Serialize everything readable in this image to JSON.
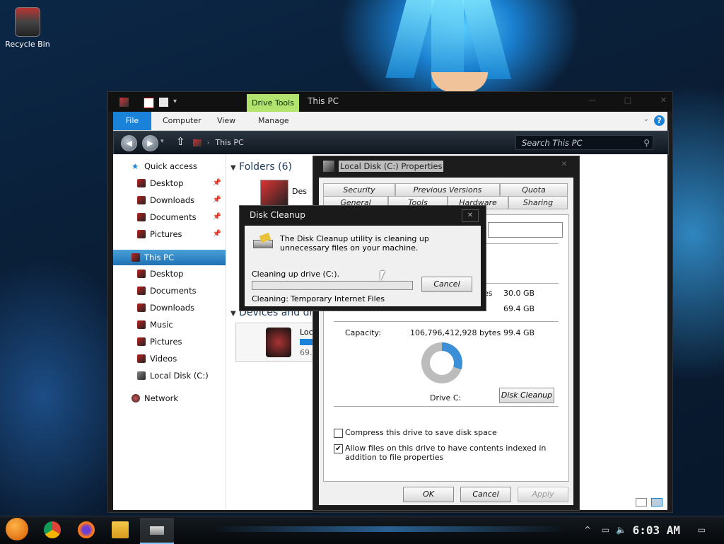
{
  "desktop": {
    "recycle_bin_label": "Recycle Bin"
  },
  "explorer": {
    "ribbon_context_tab": "Drive Tools",
    "title": "This PC",
    "tabs": [
      "File",
      "Computer",
      "View",
      "Manage"
    ],
    "address": "This PC",
    "search_placeholder": "Search This PC",
    "nav": {
      "quick_access": "Quick access",
      "quick_items": [
        "Desktop",
        "Downloads",
        "Documents",
        "Pictures"
      ],
      "this_pc": "This PC",
      "pc_items": [
        "Desktop",
        "Documents",
        "Downloads",
        "Music",
        "Pictures",
        "Videos",
        "Local Disk (C:)"
      ],
      "network": "Network"
    },
    "content": {
      "folders_header": "Folders (6)",
      "folder_partial_label": "Des",
      "devices_header": "Devices and drive",
      "drive_partial_label": "Loca",
      "drive_partial_size": "69."
    }
  },
  "properties": {
    "title": "Local Disk (C:) Properties",
    "tabs_row1": [
      "Security",
      "Previous Versions",
      "Quota"
    ],
    "tabs_row2": [
      "General",
      "Tools",
      "Hardware",
      "Sharing"
    ],
    "used_size": "30.0 GB",
    "free_size": "69.4 GB",
    "used_bytes_partial": "es",
    "capacity_label": "Capacity:",
    "capacity_bytes": "106,796,412,928 bytes",
    "capacity_size": "99.4 GB",
    "drive_label": "Drive C:",
    "disk_cleanup_button": "Disk Cleanup",
    "compress_label": "Compress this drive to save disk space",
    "index_label": "Allow files on this drive to have contents indexed in addition to file properties",
    "ok_button": "OK",
    "cancel_button": "Cancel",
    "apply_button": "Apply"
  },
  "cleanup": {
    "title": "Disk Cleanup",
    "message": "The Disk Cleanup utility is cleaning up unnecessary files on your machine.",
    "status": "Cleaning up drive  (C:).",
    "cancel_button": "Cancel",
    "cleaning_label": "Cleaning:",
    "cleaning_item": "Temporary Internet Files",
    "progress": 0.0
  },
  "taskbar": {
    "clock": "6:03 AM"
  },
  "colors": {
    "accent": "#1a82d8",
    "drive_tools": "#b3e36f",
    "selection": "#1e70b4"
  }
}
